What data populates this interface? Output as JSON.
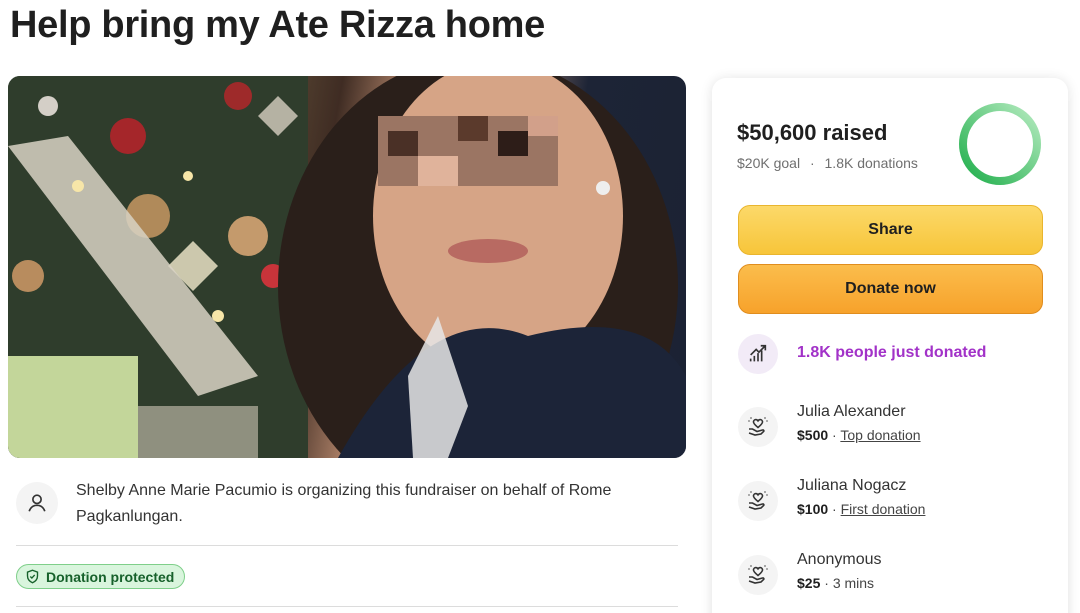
{
  "page": {
    "title": "Help bring my Ate Rizza home"
  },
  "organizer": {
    "text": "Shelby Anne Marie Pacumio is organizing this fundraiser on behalf of Rome Pagkanlungan.",
    "icon": "user-icon"
  },
  "badge": {
    "label": "Donation protected",
    "icon": "shield-check-icon",
    "color": "#17612b"
  },
  "progress": {
    "raised": "$50,600 raised",
    "goal": "$20K goal",
    "separator": "·",
    "donations": "1.8K donations",
    "fraction": 1.0,
    "color": "#1fae4b"
  },
  "actions": {
    "share_label": "Share",
    "donate_label": "Donate now"
  },
  "trending": {
    "text": "1.8K people just donated",
    "icon": "trending-up-icon",
    "color": "#a232c8"
  },
  "donors": [
    {
      "name": "Julia Alexander",
      "amount": "$500",
      "sep": " · ",
      "tag": "Top donation",
      "tag_link": true,
      "icon": "heart-hands-icon"
    },
    {
      "name": "Juliana Nogacz",
      "amount": "$100",
      "sep": " · ",
      "tag": "First donation",
      "tag_link": true,
      "icon": "heart-hands-icon"
    },
    {
      "name": "Anonymous",
      "amount": "$25",
      "sep": " · ",
      "tag": "3 mins",
      "tag_link": false,
      "icon": "heart-hands-icon"
    }
  ]
}
